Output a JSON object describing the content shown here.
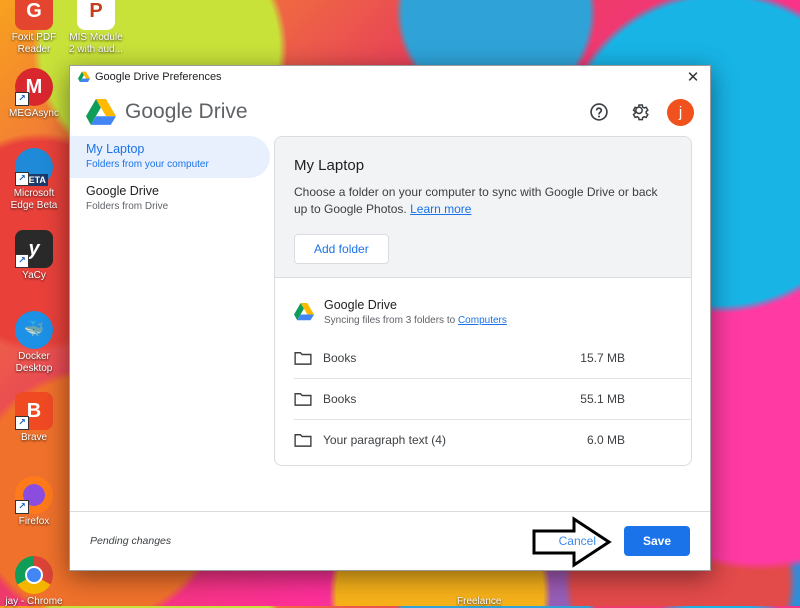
{
  "desktop": {
    "icons": [
      {
        "label": "Foxit PDF\nReader",
        "line1": "Foxit PDF",
        "line2": "Reader"
      },
      {
        "line1": "MIS Module",
        "line2": "2 with aud..."
      },
      {
        "line1": "MEGAsync",
        "line2": ""
      },
      {
        "line1": "Microsoft",
        "line2": "Edge Beta",
        "badge": "BETA"
      },
      {
        "line1": "YaCy",
        "line2": ""
      },
      {
        "line1": "Docker",
        "line2": "Desktop"
      },
      {
        "line1": "Brave",
        "line2": ""
      },
      {
        "line1": "Firefox",
        "line2": ""
      },
      {
        "line1": "jay - Chrome",
        "line2": ""
      },
      {
        "line1": "Freelance",
        "line2": ""
      }
    ]
  },
  "dialog": {
    "window_title": "Google Drive Preferences",
    "brand": "Google Drive",
    "avatar_letter": "j",
    "sidebar": [
      {
        "title": "My Laptop",
        "subtitle": "Folders from your computer"
      },
      {
        "title": "Google Drive",
        "subtitle": "Folders from Drive"
      }
    ],
    "laptop": {
      "heading": "My Laptop",
      "description": "Choose a folder on your computer to sync with Google Drive or back up to Google Photos.",
      "learn_more": "Learn more",
      "add_folder": "Add folder"
    },
    "drive": {
      "title": "Google Drive",
      "subtitle": "Syncing files from 3 folders to",
      "subtitle_link": "Computers",
      "folders": [
        {
          "name": "Books",
          "size": "15.7 MB"
        },
        {
          "name": "Books",
          "size": "55.1 MB"
        },
        {
          "name": "Your paragraph text (4)",
          "size": "6.0 MB"
        }
      ]
    },
    "footer": {
      "status": "Pending changes",
      "cancel": "Cancel",
      "save": "Save"
    }
  },
  "colors": {
    "accent": "#1a73e8",
    "avatar": "#f0511d",
    "selected_bg": "#e8f0fe"
  }
}
